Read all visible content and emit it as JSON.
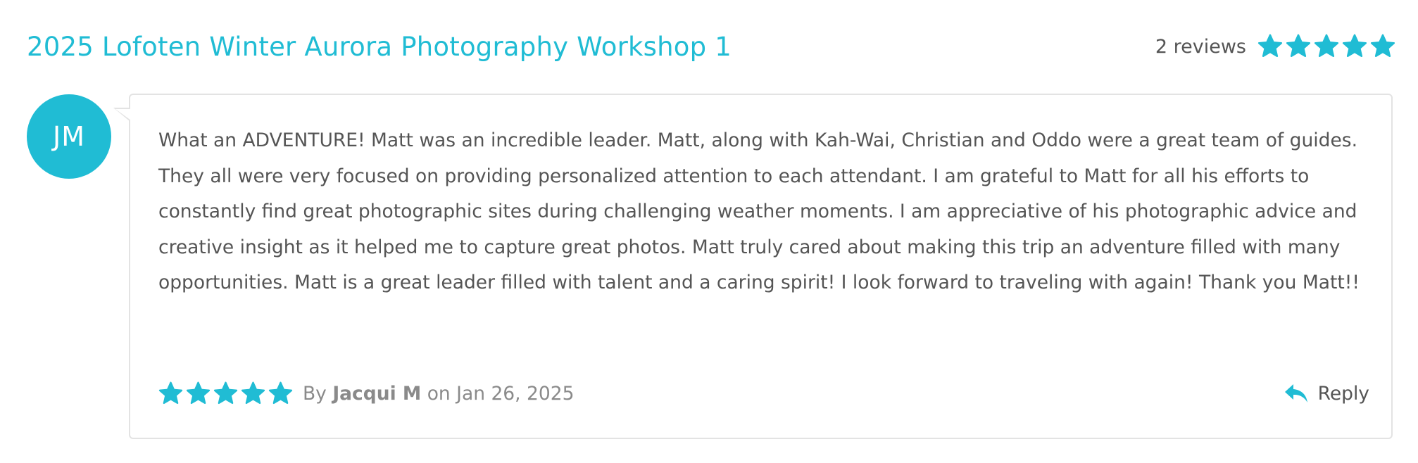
{
  "header": {
    "title": "2025 Lofoten Winter Aurora Photography Workshop 1",
    "review_count": "2 reviews",
    "rating": 5,
    "rating_max": 5
  },
  "review": {
    "avatar_initials": "JM",
    "body": "What an ADVENTURE! Matt was an incredible leader. Matt, along with Kah-Wai, Christian and Oddo were a great team of guides. They all were very focused on providing personalized attention to each attendant. I am grateful to Matt for all his efforts to constantly find great photographic sites during challenging weather moments. I am appreciative of his photographic advice and creative insight as it helped me to capture great photos. Matt truly cared about making this trip an adventure filled with many opportunities. Matt is a great leader filled with talent and a caring spirit! I look forward to traveling with again! Thank you Matt!!",
    "rating": 5,
    "rating_max": 5,
    "by_label": "By",
    "author": "Jacqui M",
    "on_label": "on",
    "date": "Jan 26, 2025",
    "reply_label": "Reply"
  },
  "colors": {
    "accent": "#20bcd4",
    "text": "#555555",
    "muted": "#8a8a8a",
    "border": "#e3e3e3"
  },
  "icons": {
    "star": "star-icon",
    "reply": "reply-arrow-icon"
  }
}
